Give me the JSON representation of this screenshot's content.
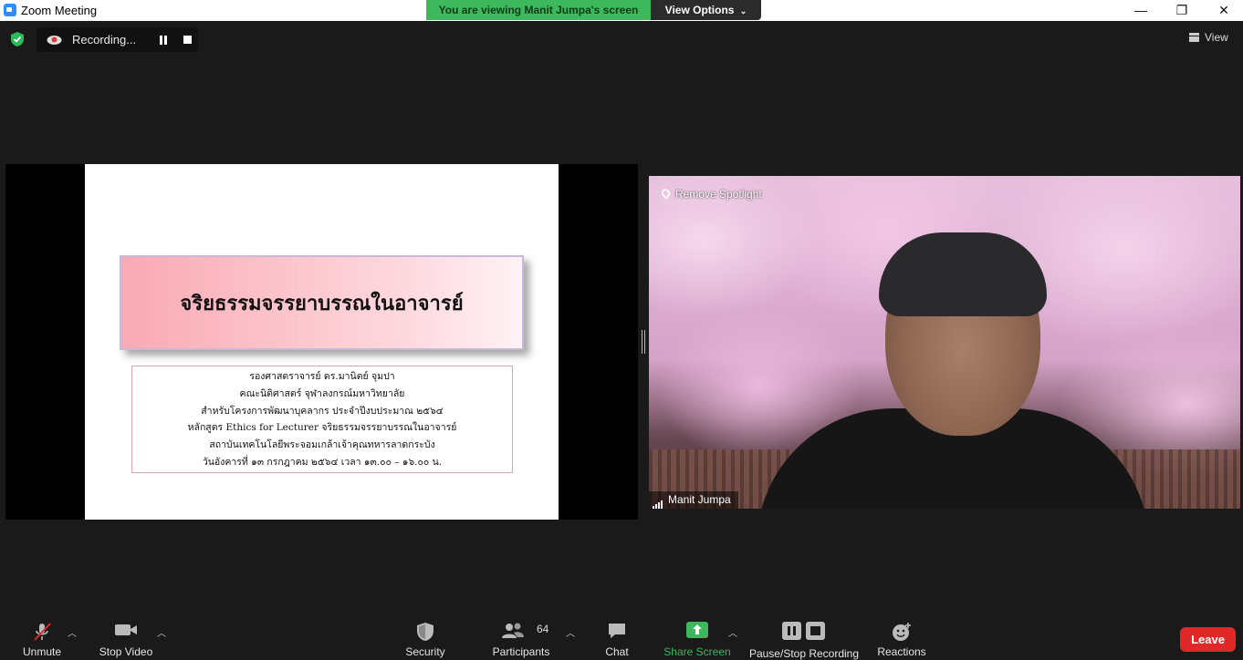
{
  "window": {
    "title": "Zoom Meeting",
    "minimize": "—",
    "maximize": "❐",
    "close": "✕"
  },
  "banner": {
    "viewing": "You are viewing Manit Jumpa's screen",
    "view_options": "View Options"
  },
  "recording": {
    "label": "Recording..."
  },
  "view_button": {
    "label": "View"
  },
  "slide": {
    "title": "จริยธรรมจรรยาบรรณในอาจารย์",
    "lines": [
      "รองศาสตราจารย์ ดร.มานิตย์ จุมปา",
      "คณะนิติศาสตร์ จุฬาลงกรณ์มหาวิทยาลัย",
      "สำหรับโครงการพัฒนาบุคลากร ประจำปีงบประมาณ ๒๕๖๔",
      "หลักสูตร Ethics for Lecturer จริยธรรมจรรยาบรรณในอาจารย์",
      "สถาบันเทคโนโลยีพระจอมเกล้าเจ้าคุณทหารลาดกระบัง",
      "วันอังคารที่ ๑๓ กรกฎาคม ๒๕๖๔ เวลา ๑๓.๐๐ – ๑๖.๐๐ น."
    ]
  },
  "video": {
    "remove_spotlight": "Remove Spotlight",
    "participant_name": "Manit Jumpa"
  },
  "toolbar": {
    "unmute": "Unmute",
    "stop_video": "Stop Video",
    "security": "Security",
    "participants": "Participants",
    "participants_count": "64",
    "chat": "Chat",
    "share_screen": "Share Screen",
    "pause_stop_recording": "Pause/Stop Recording",
    "reactions": "Reactions",
    "leave": "Leave"
  },
  "colors": {
    "share_green": "#3db85d",
    "leave_red": "#e02828",
    "bg": "#1a1a1a"
  }
}
